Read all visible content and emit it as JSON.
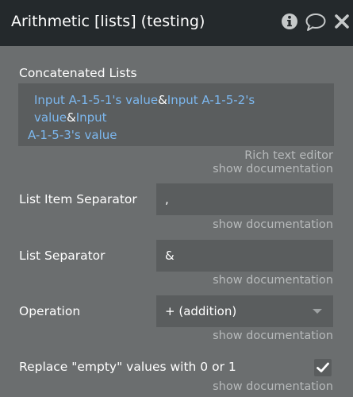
{
  "header": {
    "title": "Arithmetic [lists] (testing)",
    "icons": [
      "info-icon",
      "comment-icon",
      "close-icon"
    ]
  },
  "concatenated": {
    "label": "Concatenated Lists",
    "chip1": "Input A-1-5-1's value",
    "sep1": "&",
    "chip2": "Input A-1-5-2's value",
    "sep2": "&",
    "chip3a": "Input",
    "chip3b": "A-1-5-3's value",
    "editor_note": "Rich text editor",
    "doc": "show documentation"
  },
  "item_separator": {
    "label": "List Item Separator",
    "value": ",",
    "doc": "show documentation"
  },
  "list_separator": {
    "label": "List Separator",
    "value": "&",
    "doc": "show documentation"
  },
  "operation": {
    "label": "Operation",
    "value": "+ (addition)",
    "doc": "show documentation"
  },
  "replace_empty": {
    "label": "Replace \"empty\" values with 0 or 1",
    "checked": true,
    "doc": "show documentation"
  },
  "colors": {
    "header_bg": "#24292c",
    "panel_bg": "#6b6e6f",
    "field_bg": "#5a5d5e",
    "dynamic_text": "#7cb7ee",
    "muted_text": "#b7babb"
  }
}
